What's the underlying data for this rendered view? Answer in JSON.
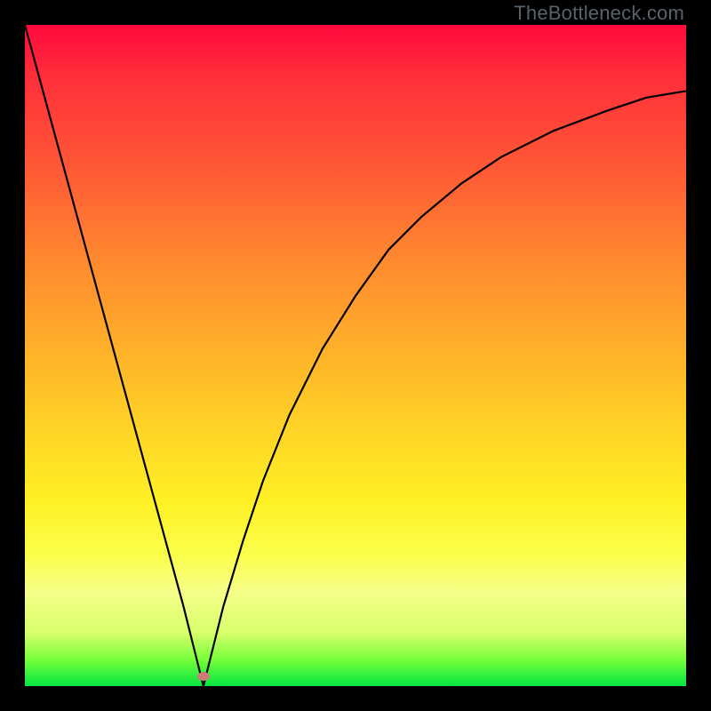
{
  "watermark": "TheBottleneck.com",
  "colors": {
    "frame": "#000000",
    "curve": "#000000",
    "marker": "#cd7a7a",
    "gradient_top": "#ff0a3c",
    "gradient_bottom": "#05e542"
  },
  "chart_data": {
    "type": "line",
    "title": "",
    "xlabel": "",
    "ylabel": "",
    "xlim": [
      0,
      1
    ],
    "ylim": [
      0,
      1
    ],
    "grid": false,
    "legend": false,
    "annotations": [],
    "marker_fraction": {
      "x": 0.27,
      "y": 0.985
    },
    "series": [
      {
        "name": "bottleneck-curve",
        "x": [
          0.0,
          0.03,
          0.06,
          0.09,
          0.12,
          0.15,
          0.18,
          0.21,
          0.24,
          0.265,
          0.27,
          0.275,
          0.3,
          0.33,
          0.36,
          0.4,
          0.45,
          0.5,
          0.55,
          0.6,
          0.66,
          0.72,
          0.8,
          0.88,
          0.94,
          1.0
        ],
        "y": [
          1.0,
          0.89,
          0.78,
          0.67,
          0.56,
          0.45,
          0.34,
          0.23,
          0.12,
          0.02,
          0.0,
          0.02,
          0.12,
          0.22,
          0.31,
          0.41,
          0.51,
          0.59,
          0.66,
          0.71,
          0.76,
          0.8,
          0.84,
          0.87,
          0.89,
          0.9
        ]
      }
    ]
  }
}
